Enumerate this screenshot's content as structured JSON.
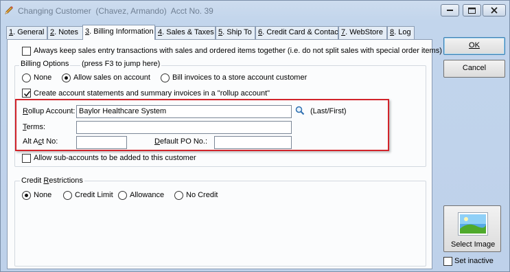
{
  "window": {
    "title": "Changing Customer  (Chavez, Armando)  Acct No. 39"
  },
  "tabs": [
    {
      "key": "1",
      "label": ". General"
    },
    {
      "key": "2",
      "label": ". Notes"
    },
    {
      "key": "3",
      "label": ". Billing Information"
    },
    {
      "key": "4",
      "label": ". Sales & Taxes"
    },
    {
      "key": "5",
      "label": ". Ship To"
    },
    {
      "key": "6",
      "label": ". Credit Card & Contact"
    },
    {
      "key": "7",
      "label": ". WebStore"
    },
    {
      "key": "8",
      "label": ". Log"
    }
  ],
  "active_tab": "3. Billing Information",
  "billing": {
    "keep_together_label": "Always keep sales entry transactions with sales and ordered items together (i.e. do not split sales with special order items)",
    "keep_together_checked": false,
    "options_group_label": "Billing Options",
    "options_hint": "(press F3 to jump here)",
    "radio_none": "None",
    "radio_allow": "Allow sales on account",
    "radio_bill": "Bill invoices to a store account customer",
    "selected_option": "Allow sales on account",
    "rollup_checkbox_label": "Create account statements and summary invoices in a \"rollup account\"",
    "rollup_checked": true,
    "rollup_account_label_acc": "R",
    "rollup_account_label_rest": "ollup Account:",
    "rollup_account_value": "Baylor Healthcare System",
    "search_hint": "(Last/First)",
    "terms_label_acc": "T",
    "terms_label_rest": "erms:",
    "terms_value": "",
    "alt_act_label_pre": "Alt A",
    "alt_act_label_acc": "c",
    "alt_act_label_post": "t No:",
    "alt_act_value": "",
    "default_po_label_pre": "",
    "default_po_label_acc": "D",
    "default_po_label_post": "efault PO No.:",
    "default_po_value": "",
    "sub_accounts_label": "Allow sub-accounts to be added to this customer",
    "sub_accounts_checked": false
  },
  "credit": {
    "group_label_pre": "Credit ",
    "group_label_acc": "R",
    "group_label_post": "estrictions",
    "radio_none": "None",
    "radio_limit": "Credit Limit",
    "radio_allowance": "Allowance",
    "radio_nocredit": "No Credit",
    "selected": "None"
  },
  "buttons": {
    "ok": "OK",
    "cancel": "Cancel",
    "select_image": "Select Image",
    "set_inactive": "Set inactive",
    "set_inactive_checked": false
  },
  "colors": {
    "highlight_box": "#d2232a",
    "window_bg": "#c2d5ec"
  }
}
